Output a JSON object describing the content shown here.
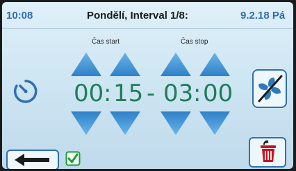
{
  "header": {
    "time": "10:08",
    "title": "Pondělí, Interval 1/8:",
    "date": "9.2.18 Pá"
  },
  "interval": {
    "start_label": "Čas start",
    "stop_label": "Čas stop",
    "start_hour": "00",
    "start_minute": "15",
    "separator": "-",
    "stop_hour": "03",
    "stop_minute": "00",
    "colon": ":"
  },
  "icons": {
    "timer": "stopwatch-icon",
    "fan": "fan-off-icon",
    "back": "back-arrow-icon",
    "check": "checkbox-checked-icon",
    "delete": "trash-icon"
  },
  "colors": {
    "accent": "#2e6fb0",
    "digits": "#1f7d5a",
    "arrow": "#3d8fd6",
    "check": "#1f9b3a",
    "delete": "#d0101a"
  }
}
